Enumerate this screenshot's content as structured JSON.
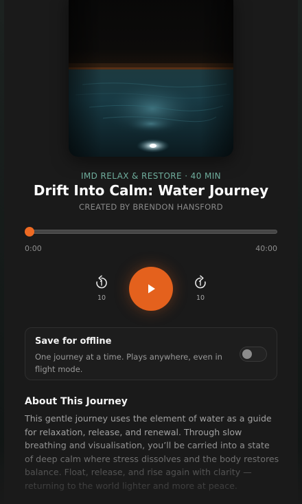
{
  "track": {
    "category": "IMD RELAX & RESTORE · 40 MIN",
    "title": "Drift Into Calm: Water Journey",
    "creator": "CREATED BY BRENDON HANSFORD"
  },
  "player": {
    "elapsed": "0:00",
    "duration": "40:00",
    "progress_fraction": 0,
    "skip_back_seconds": "10",
    "skip_forward_seconds": "10",
    "state": "paused"
  },
  "offline": {
    "title": "Save for offline",
    "description": "One journey at a time. Plays anywhere, even in flight mode.",
    "enabled": false
  },
  "about": {
    "heading": "About This Journey",
    "body": "This gentle journey uses the element of water as a guide for relaxation, release, and renewal. Through slow breathing and visualisation, you’ll be carried into a state of deep calm where stress dissolves and the body restores balance. Float, release, and rise again with clarity — returning to the world lighter and more at peace."
  },
  "colors": {
    "accent": "#e4611d",
    "category_text": "#6fae9d",
    "background": "#1a1a1a"
  },
  "icons": {
    "skip_back": "rewind-10-icon",
    "skip_forward": "forward-10-icon",
    "play": "play-icon"
  }
}
